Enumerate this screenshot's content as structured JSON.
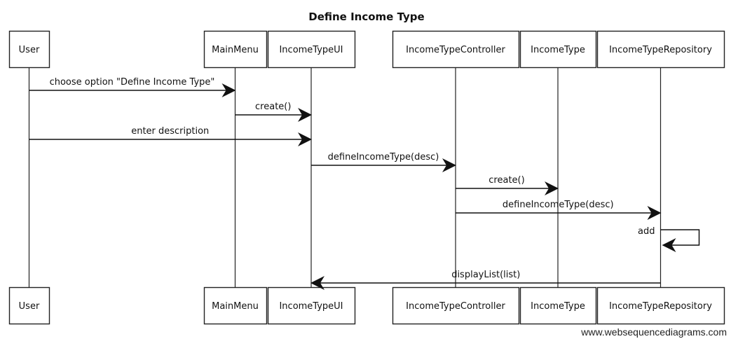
{
  "title": "Define Income Type",
  "participants": [
    {
      "id": "user",
      "label": "User"
    },
    {
      "id": "mainmenu",
      "label": "MainMenu"
    },
    {
      "id": "ui",
      "label": "IncomeTypeUI"
    },
    {
      "id": "controller",
      "label": "IncomeTypeController"
    },
    {
      "id": "incometype",
      "label": "IncomeType"
    },
    {
      "id": "repository",
      "label": "IncomeTypeRepository"
    }
  ],
  "messages": [
    {
      "from": "user",
      "to": "mainmenu",
      "label": "choose option \"Define Income Type\""
    },
    {
      "from": "mainmenu",
      "to": "ui",
      "label": "create()"
    },
    {
      "from": "user",
      "to": "ui",
      "label": "enter description"
    },
    {
      "from": "ui",
      "to": "controller",
      "label": "defineIncomeType(desc)"
    },
    {
      "from": "controller",
      "to": "incometype",
      "label": "create()"
    },
    {
      "from": "controller",
      "to": "repository",
      "label": "defineIncomeType(desc)"
    },
    {
      "from": "repository",
      "to": "repository",
      "label": "add"
    },
    {
      "from": "repository",
      "to": "ui",
      "label": "displayList(list)"
    }
  ],
  "watermark": "www.websequencediagrams.com"
}
